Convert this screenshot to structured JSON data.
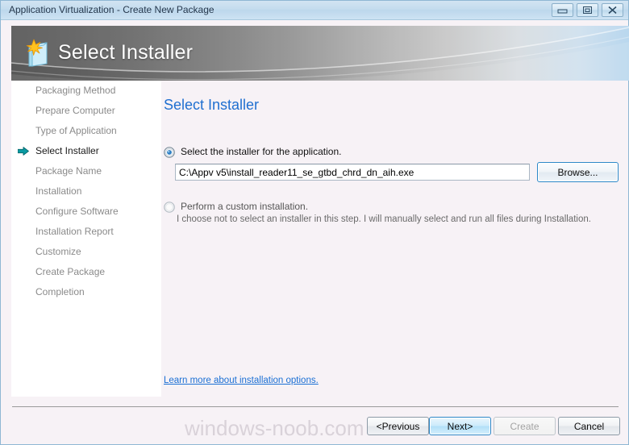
{
  "window": {
    "title": "Application Virtualization - Create New Package",
    "controls": [
      {
        "name": "minimize-button",
        "glyph": "minimize-icon"
      },
      {
        "name": "maximize-button",
        "glyph": "restore-icon"
      },
      {
        "name": "close-button",
        "glyph": "close-icon"
      }
    ]
  },
  "banner": {
    "title": "Select Installer",
    "icon": "new-package-icon"
  },
  "sidebar": {
    "active_index": 3,
    "items": [
      {
        "label": "Packaging Method"
      },
      {
        "label": "Prepare Computer"
      },
      {
        "label": "Type of Application"
      },
      {
        "label": "Select Installer"
      },
      {
        "label": "Package Name"
      },
      {
        "label": "Installation"
      },
      {
        "label": "Configure Software"
      },
      {
        "label": "Installation Report"
      },
      {
        "label": "Customize"
      },
      {
        "label": "Create Package"
      },
      {
        "label": "Completion"
      }
    ]
  },
  "main": {
    "heading": "Select Installer",
    "option_installer": {
      "label": "Select the installer for the application.",
      "selected": true
    },
    "path_field": {
      "value": "C:\\Appv v5\\install_reader11_se_gtbd_chrd_dn_aih.exe",
      "placeholder": ""
    },
    "browse_label": "Browse...",
    "option_custom": {
      "label": "Perform a custom installation.",
      "selected": false,
      "description": "I choose not to select an installer in this step.  I will manually select and run all files during Installation."
    },
    "learn_more_link": "Learn more about installation options."
  },
  "footer": {
    "previous_label": "<Previous",
    "next_label": "Next>",
    "create_label": "Create",
    "cancel_label": "Cancel"
  },
  "watermark": {
    "text": "windows-noob.com"
  },
  "colors": {
    "accent_blue": "#1f6fd0",
    "link_blue": "#1a6fd4",
    "arrow_teal": "#0a8f96",
    "banner_dark": "#585858",
    "titlebar_blue": "#c4dcee"
  }
}
